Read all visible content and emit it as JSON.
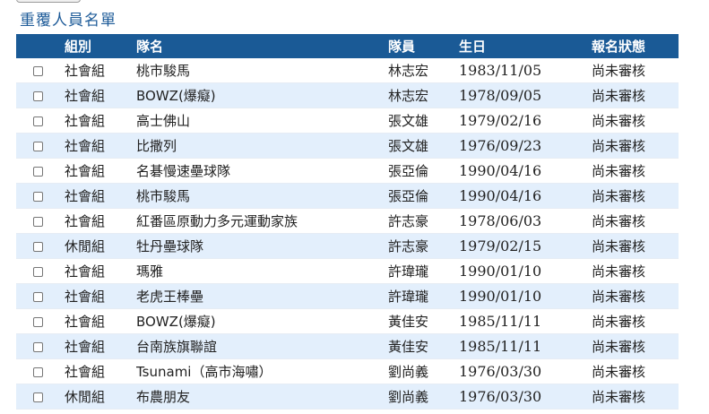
{
  "page": {
    "title": "重覆人員名單"
  },
  "table": {
    "headers": {
      "group": "組別",
      "team": "隊名",
      "member": "隊員",
      "birthday": "生日",
      "status": "報名狀態"
    },
    "rows": [
      {
        "group": "社會組",
        "team": "桃市駿馬",
        "member": "林志宏",
        "birthday": "1983/11/05",
        "status": "尚未審核"
      },
      {
        "group": "社會組",
        "team": "BOWZ(爆癡)",
        "member": "林志宏",
        "birthday": "1978/09/05",
        "status": "尚未審核"
      },
      {
        "group": "社會組",
        "team": "高士佛山",
        "member": "張文雄",
        "birthday": "1979/02/16",
        "status": "尚未審核"
      },
      {
        "group": "社會組",
        "team": "比撒列",
        "member": "張文雄",
        "birthday": "1976/09/23",
        "status": "尚未審核"
      },
      {
        "group": "社會組",
        "team": "名碁慢速壘球隊",
        "member": "張亞倫",
        "birthday": "1990/04/16",
        "status": "尚未審核"
      },
      {
        "group": "社會組",
        "team": "桃市駿馬",
        "member": "張亞倫",
        "birthday": "1990/04/16",
        "status": "尚未審核"
      },
      {
        "group": "社會組",
        "team": "紅番區原動力多元運動家族",
        "member": "許志豪",
        "birthday": "1978/06/03",
        "status": "尚未審核"
      },
      {
        "group": "休閒組",
        "team": "牡丹壘球隊",
        "member": "許志豪",
        "birthday": "1979/02/15",
        "status": "尚未審核"
      },
      {
        "group": "社會組",
        "team": "瑪雅",
        "member": "許瑋瓏",
        "birthday": "1990/01/10",
        "status": "尚未審核"
      },
      {
        "group": "社會組",
        "team": "老虎王棒壘",
        "member": "許瑋瓏",
        "birthday": "1990/01/10",
        "status": "尚未審核"
      },
      {
        "group": "社會組",
        "team": "BOWZ(爆癡)",
        "member": "黃佳安",
        "birthday": "1985/11/11",
        "status": "尚未審核"
      },
      {
        "group": "社會組",
        "team": "台南族旗聯誼",
        "member": "黃佳安",
        "birthday": "1985/11/11",
        "status": "尚未審核"
      },
      {
        "group": "社會組",
        "team": "Tsunami（高市海嘯）",
        "member": "劉尚義",
        "birthday": "1976/03/30",
        "status": "尚未審核"
      },
      {
        "group": "休閒組",
        "team": "布農朋友",
        "member": "劉尚義",
        "birthday": "1976/03/30",
        "status": "尚未審核"
      }
    ]
  }
}
